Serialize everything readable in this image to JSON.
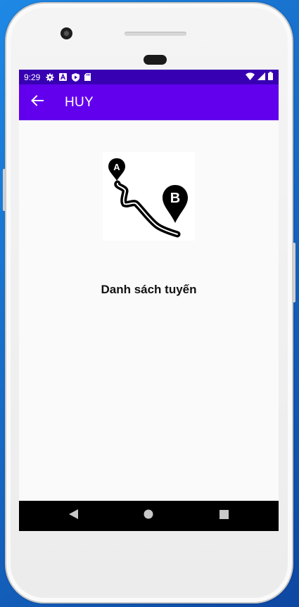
{
  "status_bar": {
    "time": "9:29",
    "left_icons": [
      "gear-icon",
      "a-box-icon",
      "shield-icon",
      "sd-card-icon"
    ],
    "right_icons": [
      "wifi-icon",
      "signal-icon",
      "battery-icon"
    ]
  },
  "app_bar": {
    "back_icon": "arrow-left-icon",
    "title": "HUY",
    "background": "#6200ee",
    "status_background": "#3700b3"
  },
  "main": {
    "route_image": {
      "icon": "route-a-to-b-icon",
      "pin_a_label": "A",
      "pin_b_label": "B"
    },
    "route_list_label": "Danh sách tuyến"
  },
  "nav_bar": {
    "buttons": [
      "back-triangle-icon",
      "home-circle-icon",
      "recents-square-icon"
    ]
  }
}
